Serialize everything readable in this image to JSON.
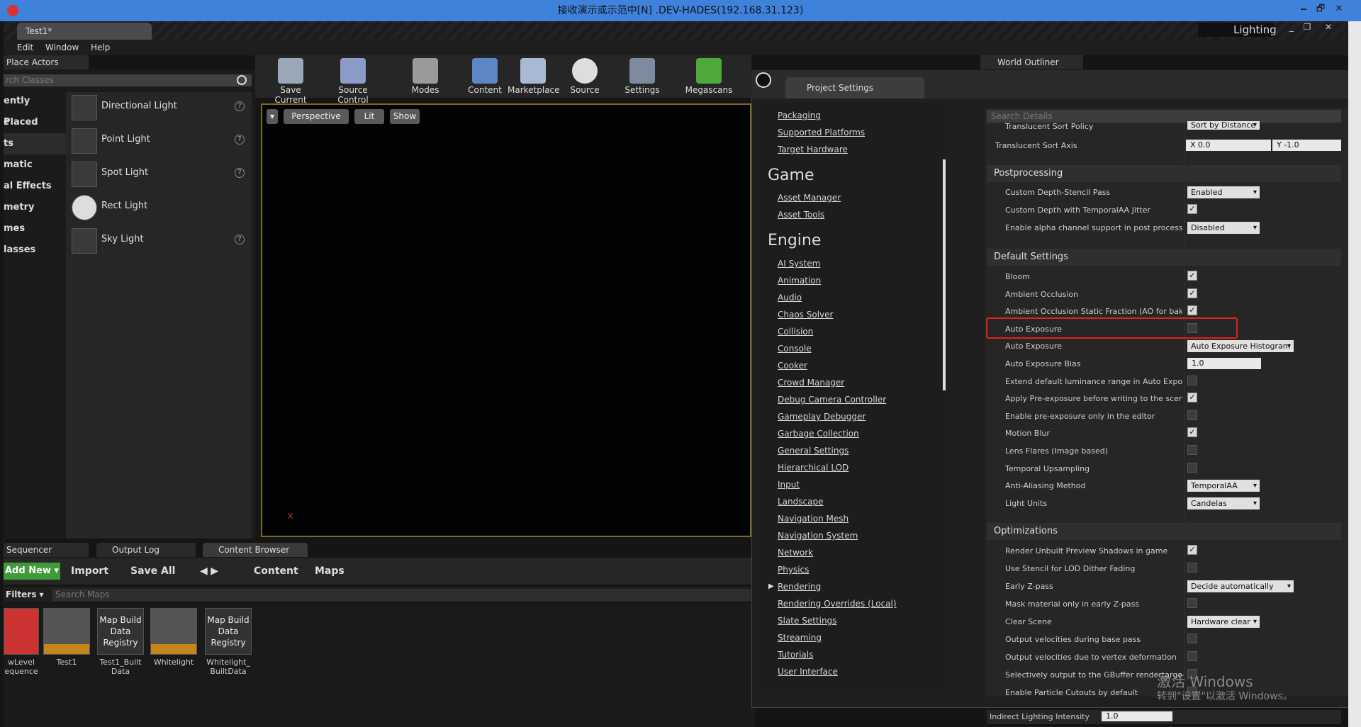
{
  "remote": {
    "title": "接收演示或示范中[N] .DEV-HADES(192.168.31.123)",
    "minimize": "🗕",
    "maximize": "🗗",
    "close": "✕"
  },
  "editor": {
    "doc_tab": "Test1*",
    "menu": [
      "Edit",
      "Window",
      "Help"
    ],
    "lighting_label": "Lighting",
    "win_btns": [
      "_",
      "❐",
      "✕"
    ]
  },
  "place_actors": {
    "tab": "Place Actors",
    "search_placeholder": "rch Classes",
    "categories": [
      "ently Placed",
      "c",
      "ts",
      "matic",
      "al Effects",
      "metry",
      "mes",
      "lasses"
    ],
    "selected_category_index": 2,
    "actors": [
      {
        "name": "Directional Light",
        "help": "?"
      },
      {
        "name": "Point Light",
        "help": "?"
      },
      {
        "name": "Spot Light",
        "help": "?"
      },
      {
        "name": "Rect Light",
        "help": ""
      },
      {
        "name": "Sky Light",
        "help": "?"
      }
    ]
  },
  "toolbar": {
    "buttons": [
      "Save Current",
      "Source Control",
      "Modes",
      "Content",
      "Marketplace",
      "Source",
      "Settings",
      "Megascans"
    ]
  },
  "viewport": {
    "perspective": "Perspective",
    "lit": "Lit",
    "show": "Show",
    "axis_label": "X"
  },
  "bottom": {
    "tabs": [
      "Sequencer",
      "Output Log",
      "Content Browser"
    ],
    "add_new": "Add New ▾",
    "import": "Import",
    "save_all": "Save All",
    "path": [
      "Content",
      "Maps"
    ],
    "filters": "Filters ▾",
    "search_placeholder": "Search Maps",
    "assets": [
      {
        "tile": "",
        "label": "wLevel\nequence"
      },
      {
        "tile": "",
        "label": "Test1"
      },
      {
        "tile": "Map Build Data Registry",
        "label": "Test1_Built Data"
      },
      {
        "tile": "",
        "label": "Whitelight"
      },
      {
        "tile": "Map Build Data Registry",
        "label": "Whitelight_ BuiltData"
      }
    ]
  },
  "project_settings": {
    "tab": "Project Settings",
    "nav_top": [
      "Packaging",
      "Supported Platforms",
      "Target Hardware"
    ],
    "nav_game_head": "Game",
    "nav_game": [
      "Asset Manager",
      "Asset Tools"
    ],
    "nav_engine_head": "Engine",
    "nav_engine": [
      "AI System",
      "Animation",
      "Audio",
      "Chaos Solver",
      "Collision",
      "Console",
      "Cooker",
      "Crowd Manager",
      "Debug Camera Controller",
      "Gameplay Debugger",
      "Garbage Collection",
      "General Settings",
      "Hierarchical LOD",
      "Input",
      "Landscape",
      "Navigation Mesh",
      "Navigation System",
      "Network",
      "Physics",
      "Rendering",
      "Rendering Overrides (Local)",
      "Slate Settings",
      "Streaming",
      "Tutorials",
      "User Interface"
    ],
    "search_placeholder": "Search Details",
    "translucent_sort_policy": {
      "label": "Translucent Sort Policy",
      "value": "Sort by Distance"
    },
    "translucent_sort_axis": {
      "label": "Translucent Sort Axis",
      "x": "X  0.0",
      "y": "Y  -1.0"
    },
    "postprocessing": {
      "head": "Postprocessing",
      "rows": [
        {
          "label": "Custom Depth-Stencil Pass",
          "dropdown": "Enabled"
        },
        {
          "label": "Custom Depth with TemporalAA Jitter",
          "check": true
        },
        {
          "label": "Enable alpha channel support in post processing (e",
          "dropdown": "Disabled"
        }
      ]
    },
    "default_settings": {
      "head": "Default Settings",
      "rows": [
        {
          "label": "Bloom",
          "check": true
        },
        {
          "label": "Ambient Occlusion",
          "check": true
        },
        {
          "label": "Ambient Occlusion Static Fraction (AO for baked li",
          "check": true
        },
        {
          "label": "Auto Exposure",
          "check": false
        },
        {
          "label": "Auto Exposure",
          "dropdown": "Auto Exposure Histogram"
        },
        {
          "label": "Auto Exposure Bias",
          "number": "1.0"
        },
        {
          "label": "Extend default luminance range in Auto Exposure s",
          "check": false
        },
        {
          "label": "Apply Pre-exposure before writing to the scene co",
          "check": true
        },
        {
          "label": "Enable pre-exposure only in the editor",
          "check": false
        },
        {
          "label": "Motion Blur",
          "check": true
        },
        {
          "label": "Lens Flares (Image based)",
          "check": false
        },
        {
          "label": "Temporal Upsampling",
          "check": false
        },
        {
          "label": "Anti-Aliasing Method",
          "dropdown": "TemporalAA"
        },
        {
          "label": "Light Units",
          "dropdown": "Candelas"
        }
      ]
    },
    "optimizations": {
      "head": "Optimizations",
      "rows": [
        {
          "label": "Render Unbuilt Preview Shadows in game",
          "check": true
        },
        {
          "label": "Use Stencil for LOD Dither Fading",
          "check": false
        },
        {
          "label": "Early Z-pass",
          "dropdown": "Decide automatically"
        },
        {
          "label": "Mask material only in early Z-pass",
          "check": false
        },
        {
          "label": "Clear Scene",
          "dropdown": "Hardware clear"
        },
        {
          "label": "Output velocities during base pass",
          "check": false
        },
        {
          "label": "Output velocities due to vertex deformation",
          "check": false
        },
        {
          "label": "Selectively output to the GBuffer rendertargets",
          "check": false
        },
        {
          "label": "Enable Particle Cutouts by default",
          "check": false
        }
      ]
    }
  },
  "world_outliner": {
    "tab": "World Outliner"
  },
  "indirect_lighting": {
    "label": "Indirect Lighting Intensity",
    "value": "1.0"
  },
  "activation": {
    "line1": "激活 Windows",
    "line2": "转到\"设置\"以激活 Windows。"
  },
  "colors": {
    "accent": "#3f82dc",
    "highlight": "#e02020",
    "add_new_green": "#3f9a3a"
  }
}
